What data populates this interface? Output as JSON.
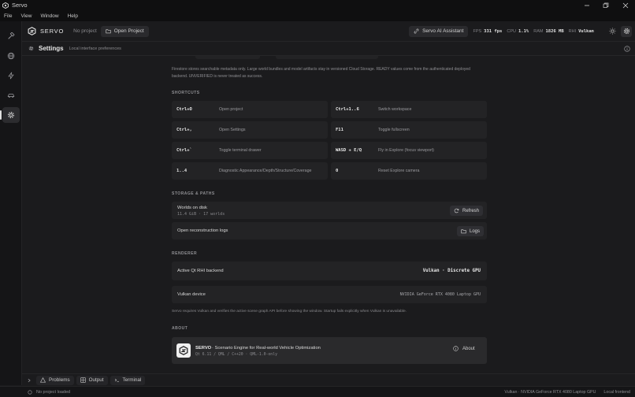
{
  "window": {
    "title": "Servo"
  },
  "menu": [
    "File",
    "View",
    "Window",
    "Help"
  ],
  "header": {
    "brand": "SERVO",
    "project_state": "No project",
    "open_project": "Open Project",
    "assistant": "Servo AI Assistant",
    "stats": [
      {
        "label": "FPS",
        "value": "331 fps"
      },
      {
        "label": "CPU",
        "value": "1.1%"
      },
      {
        "label": "RAM",
        "value": "1826 MB"
      },
      {
        "label": "RHI",
        "value": "Vulkan"
      }
    ]
  },
  "page": {
    "title": "Settings",
    "subtitle": "Local interface preferences"
  },
  "intro_text": "Firestore stores searchable metadata only. Large world bundles and model artifacts stay in versioned Cloud Storage. READY values come from the authenticated deployed backend. UNVERIFIED is never treated as success.",
  "shortcuts": {
    "title": "SHORTCUTS",
    "items": [
      {
        "key": "Ctrl+O",
        "desc": "Open project"
      },
      {
        "key": "Ctrl+1..6",
        "desc": "Switch workspace"
      },
      {
        "key": "Ctrl+,",
        "desc": "Open Settings"
      },
      {
        "key": "F11",
        "desc": "Toggle fullscreen"
      },
      {
        "key": "Ctrl+`",
        "desc": "Toggle terminal drawer"
      },
      {
        "key": "WASD + E/Q",
        "desc": "Fly in Explore (focus viewport)"
      },
      {
        "key": "1..4",
        "desc": "Diagnostic Appearance/Depth/Structure/Coverage"
      },
      {
        "key": "0",
        "desc": "Reset Explore camera"
      }
    ]
  },
  "storage": {
    "title": "STORAGE & PATHS",
    "worlds_label": "Worlds on disk",
    "worlds_detail": "11.4 GiB · 17 worlds",
    "refresh": "Refresh",
    "recon_label": "Open reconstruction logs",
    "logs": "Logs"
  },
  "renderer": {
    "title": "RENDERER",
    "backend_label": "Active Qt RHI backend",
    "backend_value": "Vulkan · Discrete GPU",
    "device_label": "Vulkan device",
    "device_value": "NVIDIA GeForce RTX 4080 Laptop GPU",
    "note": "Servo requires Vulkan and verifies the active scene graph API before showing the window. Startup fails explicitly when Vulkan is unavailable."
  },
  "about": {
    "title": "ABOUT",
    "name": "SERVO",
    "tagline": "· Scenario Engine for Real-world Vehicle Optimization",
    "version": "Qt 6.11 / QML / C++20 · QML-1.0-only",
    "button": "About"
  },
  "bottom_tabs": [
    "Problems",
    "Output",
    "Terminal"
  ],
  "status": {
    "left": "No project loaded",
    "gpu": "Vulkan · NVIDIA GeForce RTX 4080 Laptop GPU",
    "mode": "Local frontend"
  }
}
